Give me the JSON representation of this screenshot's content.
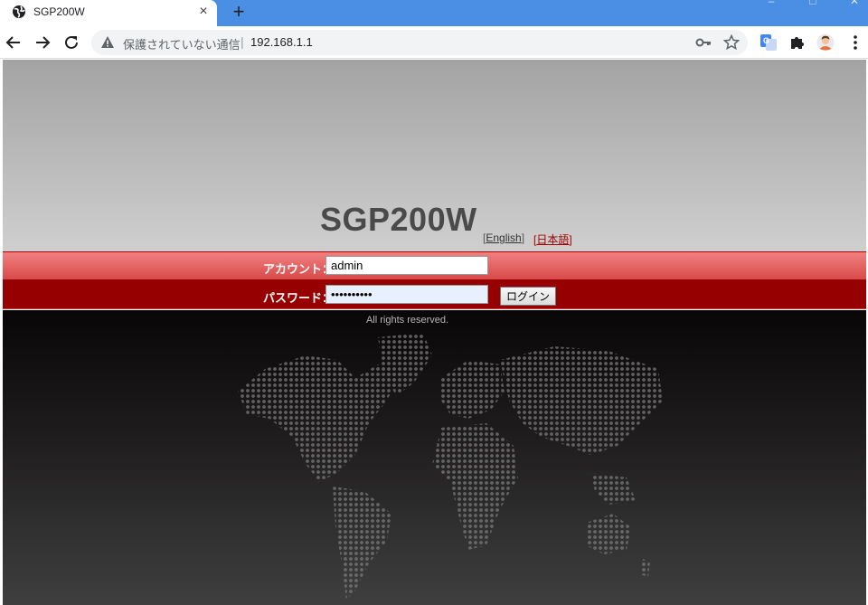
{
  "browser": {
    "tab_title": "SGP200W",
    "tab_close": "×",
    "new_tab": "+",
    "window_controls": [
      "–",
      "□",
      "✕"
    ],
    "omnibox_warning": "保護されていない通信",
    "omnibox_separator": "|",
    "url": "192.168.1.1",
    "icons": [
      "back-arrow-icon",
      "forward-arrow-icon",
      "reload-icon",
      "warning-icon",
      "key-icon",
      "star-icon",
      "translate-icon",
      "puzzle-icon",
      "profile-avatar-icon",
      "kebab-menu-icon"
    ]
  },
  "page": {
    "brand": "SGP200W",
    "lang_english": "English",
    "lang_japanese": "日本語",
    "lang_bracket_open": "[",
    "lang_bracket_close": "]",
    "account_label": "アカウント：",
    "account_value": "admin",
    "password_label": "パスワード：",
    "password_value": "••••••••••",
    "login_button": "ログイン",
    "copyright": "All rights reserved."
  },
  "colors": {
    "tabbar": "#4a8fe4",
    "band_light_red": "#e86060",
    "band_dark_red": "#960000",
    "brand_text": "#4a4a4a"
  }
}
